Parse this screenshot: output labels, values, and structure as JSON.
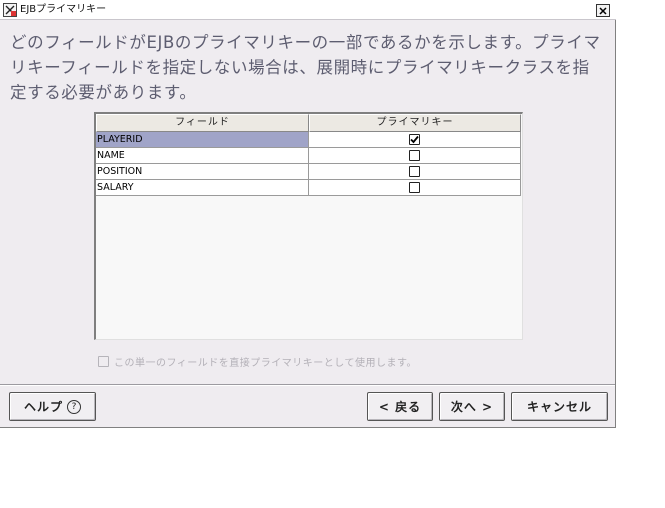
{
  "window": {
    "title": "EJBプライマリキー"
  },
  "description": "どのフィールドがEJBのプライマリキーの一部であるかを示します。プライマリキーフィールドを指定しない場合は、展開時にプライマリキークラスを指定する必要があります。",
  "table": {
    "headers": [
      "フィールド",
      "プライマリキー"
    ],
    "rows": [
      {
        "field": "PLAYERID",
        "primary_key": true,
        "selected": true
      },
      {
        "field": "NAME",
        "primary_key": false,
        "selected": false
      },
      {
        "field": "POSITION",
        "primary_key": false,
        "selected": false
      },
      {
        "field": "SALARY",
        "primary_key": false,
        "selected": false
      }
    ]
  },
  "direct_checkbox": {
    "label": "この単一のフィールドを直接プライマリキーとして使用します。",
    "checked": false,
    "enabled": false
  },
  "buttons": {
    "help": "ヘルプ",
    "help_icon": "?",
    "back": "< 戻る",
    "next": "次へ >",
    "cancel": "キャンセル"
  },
  "colors": {
    "dialog_bg": "#efecf0",
    "selection": "#a0a4c8",
    "description_text": "#5d5d70"
  }
}
